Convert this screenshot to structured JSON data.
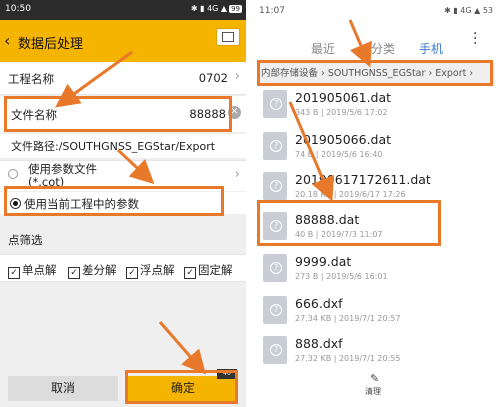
{
  "left": {
    "status": {
      "time": "10:50",
      "icons": "✱ ▮ 4G ▲",
      "battery": "99"
    },
    "title": {
      "back": "‹",
      "text": "数据后处理"
    },
    "project": {
      "label": "工程名称",
      "value": "0702"
    },
    "file": {
      "label": "文件名称",
      "value": "88888",
      "clear": "✕"
    },
    "path": {
      "label": "文件路径:/SOUTHGNSS_EGStar/Export"
    },
    "param_file": {
      "line1": "使用参数文件",
      "line2": "(*.cot)"
    },
    "current_param": {
      "label": "使用当前工程中的参数"
    },
    "filter": {
      "header": "点筛选",
      "options": [
        {
          "label": "单点解",
          "checked": true
        },
        {
          "label": "差分解",
          "checked": true
        },
        {
          "label": "浮点解",
          "checked": true
        },
        {
          "label": "固定解",
          "checked": true
        }
      ]
    },
    "buttons": {
      "cancel": "取消",
      "ok": "确定"
    },
    "badge": "40"
  },
  "right": {
    "status": {
      "time": "11:07",
      "icons": "✱ ▮ 4G ▲ 53"
    },
    "tabs": {
      "recent": "最近",
      "category": "分类",
      "phone": "手机"
    },
    "breadcrumb": {
      "root": "内部存储设备",
      "dir1": "SOUTHGNSS_EGStar",
      "dir2": "Export"
    },
    "files": [
      {
        "name": "201905061.dat",
        "meta": "343 B | 2019/5/6 17:02"
      },
      {
        "name": "201905066.dat",
        "meta": "74 B | 2019/5/6 16:40"
      },
      {
        "name": "20190617172611.dat",
        "meta": "20.18 KB | 2019/6/17 17:26"
      },
      {
        "name": "88888.dat",
        "meta": "40 B | 2019/7/3 11:07"
      },
      {
        "name": "9999.dat",
        "meta": "273 B | 2019/5/6 16:01"
      },
      {
        "name": "666.dxf",
        "meta": "27.34 KB | 2019/7/1 20:57"
      },
      {
        "name": "888.dxf",
        "meta": "27.32 KB | 2019/7/1 20:55"
      }
    ],
    "clean": "清理"
  },
  "colors": {
    "accent": "#f5b400",
    "highlight": "#e8782a",
    "tab_active": "#3a7bd5"
  }
}
